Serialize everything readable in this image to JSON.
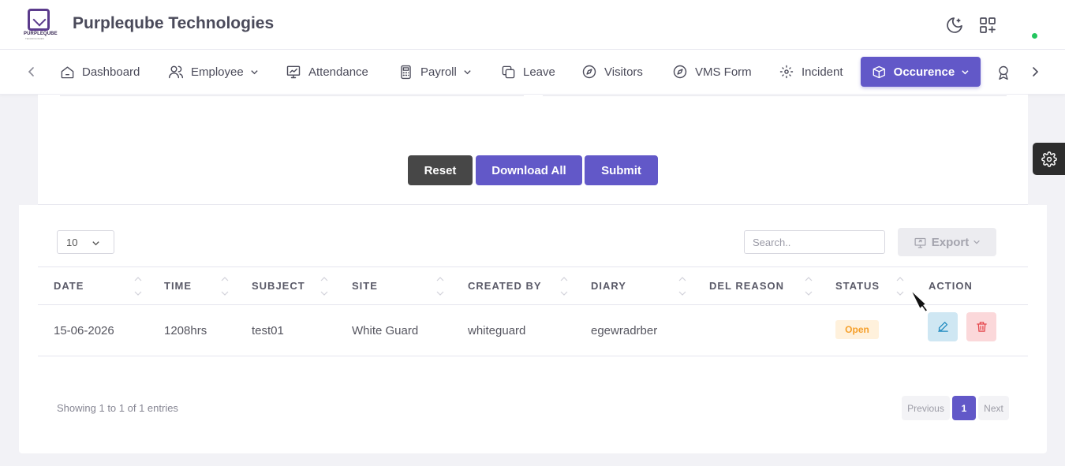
{
  "header": {
    "company": "Purpleqube Technologies",
    "logo_text": "PURPLEQUBE",
    "logo_sub": "TECHNOLOGIES",
    "icons": [
      "moon-icon",
      "apps-grid-icon"
    ]
  },
  "nav": {
    "items": [
      {
        "label": "Dashboard",
        "icon": "home-icon"
      },
      {
        "label": "Employee",
        "icon": "users-icon",
        "dropdown": true
      },
      {
        "label": "Attendance",
        "icon": "chart-monitor-icon"
      },
      {
        "label": "Payroll",
        "icon": "calculator-icon",
        "dropdown": true
      },
      {
        "label": "Leave",
        "icon": "copy-icon"
      },
      {
        "label": "Visitors",
        "icon": "compass-icon"
      },
      {
        "label": "VMS Form",
        "icon": "compass-icon"
      },
      {
        "label": "Incident",
        "icon": "focus-icon"
      },
      {
        "label": "Occurence",
        "icon": "box-icon",
        "dropdown": true,
        "active": true
      }
    ]
  },
  "form": {
    "reset": "Reset",
    "download_all": "Download All",
    "submit": "Submit"
  },
  "table": {
    "page_length": "10",
    "search_placeholder": "Search..",
    "export": "Export",
    "columns": [
      "DATE",
      "TIME",
      "SUBJECT",
      "SITE",
      "CREATED BY",
      "DIARY",
      "DEL REASON",
      "STATUS",
      "ACTION"
    ],
    "rows": [
      {
        "date": "15-06-2026",
        "time": "1208hrs",
        "subject": "test01",
        "site": "White Guard",
        "created_by": "whiteguard",
        "diary": "egewradrber",
        "del_reason": "",
        "status": "Open"
      }
    ],
    "info": "Showing 1 to 1 of 1 entries",
    "pagination": {
      "previous": "Previous",
      "current": "1",
      "next": "Next"
    }
  },
  "colors": {
    "accent": "#6258c8",
    "reset_button": "#474747",
    "status_open_bg": "#fff1dc",
    "status_open_text": "#f59f2a",
    "online": "#22c55e"
  }
}
